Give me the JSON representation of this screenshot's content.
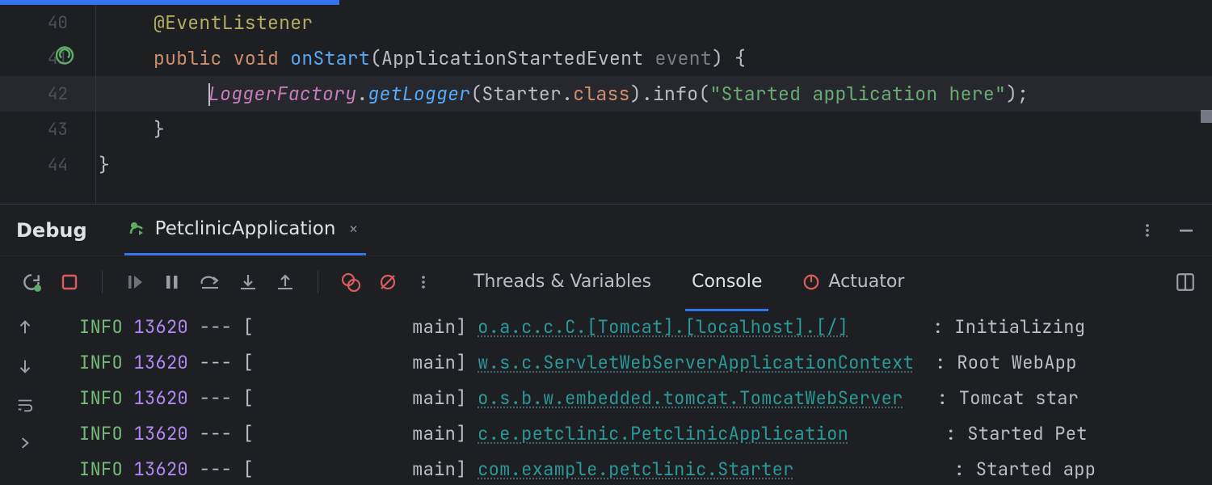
{
  "editor": {
    "lines": {
      "l40": {
        "num": "40",
        "anno": "@EventListener"
      },
      "l41": {
        "num": "41",
        "kw_public": "public",
        "kw_void": "void",
        "mname": "onStart",
        "open": "(",
        "type": "ApplicationStartedEvent",
        "param": "event",
        "close": ")",
        "brace": " {"
      },
      "l42": {
        "num": "42",
        "static": "LoggerFactory",
        "dot1": ".",
        "m1": "getLogger",
        "arg1a": "(Starter.",
        "klass": "class",
        "arg1b": ").",
        "m2": "info",
        "open": "(",
        "str": "\"Started application here\"",
        "close": ");"
      },
      "l43": {
        "num": "43",
        "brace": "}"
      },
      "l44": {
        "num": "44",
        "brace": "}"
      }
    }
  },
  "debug": {
    "title": "Debug",
    "run_tab": "PetclinicApplication"
  },
  "toolbar": {
    "tabs": {
      "threads": "Threads & Variables",
      "console": "Console",
      "actuator": "Actuator"
    }
  },
  "console": {
    "rows": {
      "r0": {
        "level": "INFO",
        "pid": "13620",
        "dash": "---",
        "br": "[",
        "thread": "main]",
        "logger": "o.a.c.c.C.[Tomcat].[localhost].[/]",
        "msg": "Initializing"
      },
      "r1": {
        "level": "INFO",
        "pid": "13620",
        "dash": "---",
        "br": "[",
        "thread": "main]",
        "logger": "w.s.c.ServletWebServerApplicationContext",
        "msg": "Root WebApp"
      },
      "r2": {
        "level": "INFO",
        "pid": "13620",
        "dash": "---",
        "br": "[",
        "thread": "main]",
        "logger": "o.s.b.w.embedded.tomcat.TomcatWebServer",
        "msg": "Tomcat star"
      },
      "r3": {
        "level": "INFO",
        "pid": "13620",
        "dash": "---",
        "br": "[",
        "thread": "main]",
        "logger": "c.e.petclinic.PetclinicApplication",
        "msg": "Started Pet"
      },
      "r4": {
        "level": "INFO",
        "pid": "13620",
        "dash": "---",
        "br": "[",
        "thread": "main]",
        "logger": "com.example.petclinic.Starter",
        "msg": "Started app"
      }
    }
  }
}
